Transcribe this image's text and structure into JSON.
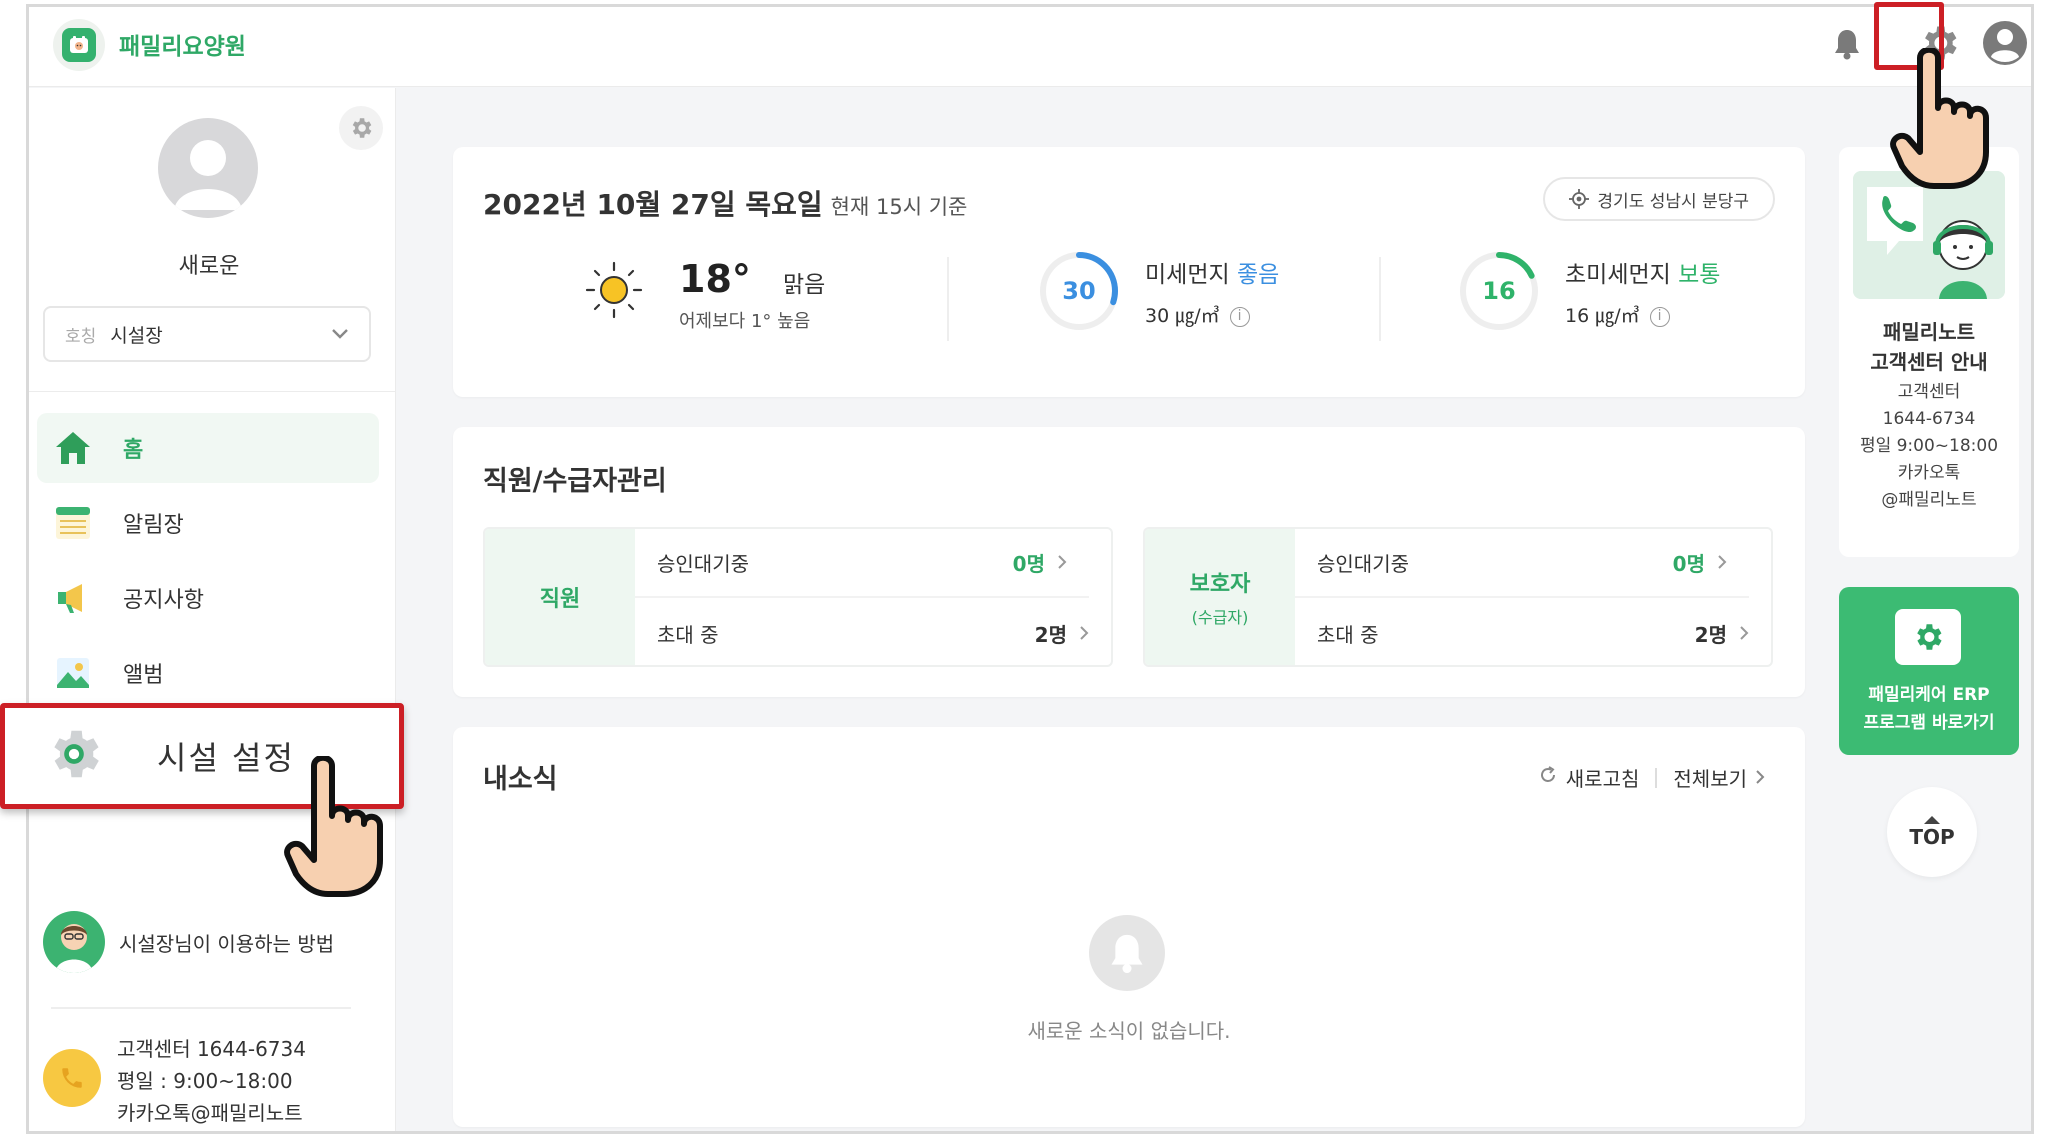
{
  "header": {
    "app_title": "패밀리요양원"
  },
  "sidebar": {
    "user_name": "새로운",
    "title_select": {
      "label": "호칭",
      "value": "시설장"
    },
    "nav": [
      {
        "label": "홈"
      },
      {
        "label": "알림장"
      },
      {
        "label": "공지사항"
      },
      {
        "label": "앨범"
      }
    ],
    "facility_settings": "시설 설정",
    "help_label": "시설장님이 이용하는 방법",
    "contact": [
      "고객센터 1644-6734",
      "평일 : 9:00~18:00",
      "카카오톡@패밀리노트"
    ]
  },
  "weather": {
    "date": "2022년 10월 27일 목요일",
    "basis": "현재 15시 기준",
    "location": "경기도 성남시 분당구",
    "temp": "18°",
    "condition": "맑음",
    "compare": "어제보다 1° 높음",
    "pm10": {
      "label": "미세먼지",
      "grade": "좋음",
      "num": "30",
      "value": "30 ㎍/㎥",
      "level": 0.3,
      "color": "#3b8fe0"
    },
    "pm25": {
      "label": "초미세먼지",
      "grade": "보통",
      "num": "16",
      "value": "16 ㎍/㎥",
      "level": 0.18,
      "color": "#2fb36a"
    }
  },
  "staff": {
    "title": "직원/수급자관리",
    "groups": [
      {
        "tag": "직원",
        "tag_sub": "",
        "rows": [
          {
            "label": "승인대기중",
            "count": "0명"
          },
          {
            "label": "초대 중",
            "count": "2명"
          }
        ]
      },
      {
        "tag": "보호자",
        "tag_sub": "(수급자)",
        "rows": [
          {
            "label": "승인대기중",
            "count": "0명"
          },
          {
            "label": "초대 중",
            "count": "2명"
          }
        ]
      }
    ]
  },
  "news": {
    "title": "내소식",
    "refresh": "새로고침",
    "view_all": "전체보기",
    "empty": "새로운 소식이 없습니다."
  },
  "customer_center": {
    "title": [
      "패밀리노트",
      "고객센터 안내"
    ],
    "info": [
      "고객센터",
      "1644-6734",
      "평일 9:00~18:00",
      "카카오톡",
      "@패밀리노트"
    ]
  },
  "erp_button": [
    "패밀리케어 ERP",
    "프로그램 바로가기"
  ],
  "top_button": "TOP",
  "colors": {
    "brand": "#2fa866",
    "highlight": "#cc1f25",
    "erp": "#3cbb73"
  }
}
